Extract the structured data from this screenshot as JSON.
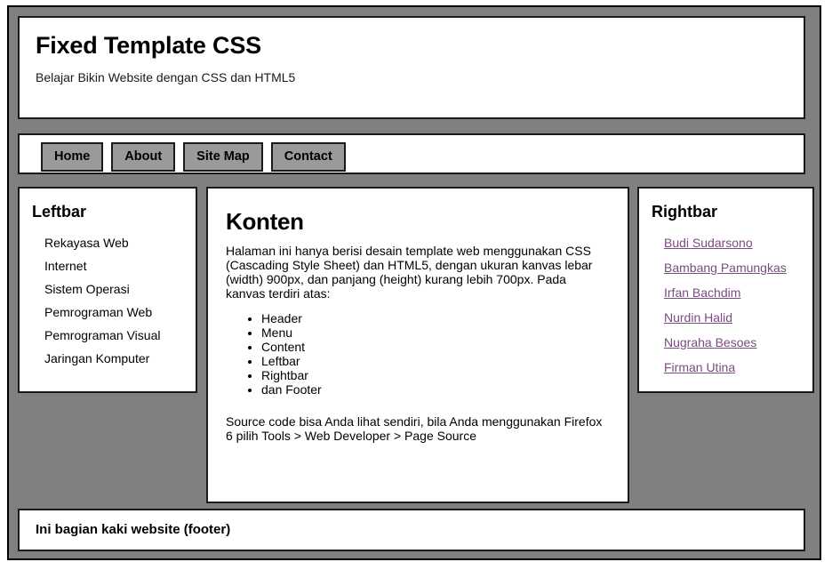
{
  "header": {
    "title": "Fixed Template CSS",
    "tagline": "Belajar Bikin Website dengan CSS dan HTML5"
  },
  "menu": {
    "items": [
      {
        "label": "Home"
      },
      {
        "label": "About"
      },
      {
        "label": "Site Map"
      },
      {
        "label": "Contact"
      }
    ]
  },
  "leftbar": {
    "title": "Leftbar",
    "items": [
      {
        "label": "Rekayasa Web"
      },
      {
        "label": "Internet"
      },
      {
        "label": "Sistem Operasi"
      },
      {
        "label": "Pemrograman Web"
      },
      {
        "label": "Pemrograman Visual"
      },
      {
        "label": "Jaringan Komputer"
      }
    ]
  },
  "content": {
    "title": "Konten",
    "intro": "Halaman ini hanya berisi desain template web menggunakan CSS (Cascading Style Sheet) dan HTML5, dengan ukuran kanvas lebar (width) 900px, dan panjang (height) kurang lebih 700px. Pada kanvas terdiri atas:",
    "parts": [
      {
        "label": "Header"
      },
      {
        "label": "Menu"
      },
      {
        "label": "Content"
      },
      {
        "label": "Leftbar"
      },
      {
        "label": "Rightbar"
      },
      {
        "label": "dan Footer"
      }
    ],
    "source_note": "Source code bisa Anda lihat sendiri, bila Anda menggunakan Firefox 6 pilih Tools > Web Developer > Page Source"
  },
  "rightbar": {
    "title": "Rightbar",
    "links": [
      {
        "label": "Budi Sudarsono"
      },
      {
        "label": "Bambang Pamungkas"
      },
      {
        "label": "Irfan Bachdim"
      },
      {
        "label": "Nurdin Halid"
      },
      {
        "label": "Nugraha Besoes"
      },
      {
        "label": "Firman Utina"
      }
    ]
  },
  "footer": {
    "text": "Ini bagian kaki website (footer)"
  },
  "colors": {
    "canvas": "#808080",
    "panel_background": "#ffffff",
    "panel_border": "#1a1a1a",
    "menu_button": "#9a9a9a",
    "link": "#7b4b82",
    "text": "#000000"
  }
}
